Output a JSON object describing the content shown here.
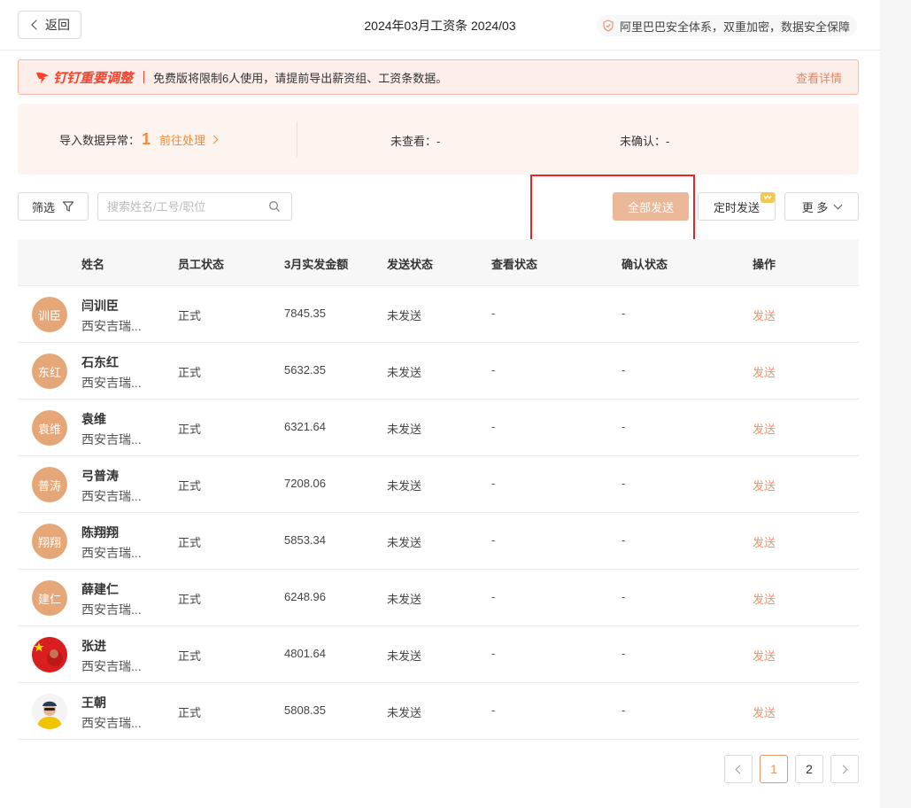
{
  "header": {
    "back_label": "返回",
    "title": "2024年03月工资条 2024/03",
    "security_text": "阿里巴巴安全体系，双重加密，数据安全保障"
  },
  "notice": {
    "brand": "钉钉重要调整",
    "message": "免费版将限制6人使用，请提前导出薪资组、工资条数据。",
    "detail_link": "查看详情"
  },
  "stats": {
    "import_label": "导入数据异常：",
    "import_count": "1",
    "import_action": "前往处理",
    "unviewed": "未查看：-",
    "unconfirmed": "未确认：-"
  },
  "toolbar": {
    "filter_label": "筛选",
    "search_placeholder": "搜索姓名/工号/职位",
    "send_all_label": "全部发送",
    "timed_send_label": "定时发送",
    "more_label": "更 多"
  },
  "table": {
    "columns": [
      "姓名",
      "员工状态",
      "3月实发金额",
      "发送状态",
      "查看状态",
      "确认状态",
      "操作"
    ],
    "rows": [
      {
        "avatar_text": "训臣",
        "avatar_type": "text",
        "name": "闫训臣",
        "org": "西安吉瑞...",
        "status": "正式",
        "amount": "7845.35",
        "send_status": "未发送",
        "view_status": "-",
        "confirm_status": "-",
        "action": "发送"
      },
      {
        "avatar_text": "东红",
        "avatar_type": "text",
        "name": "石东红",
        "org": "西安吉瑞...",
        "status": "正式",
        "amount": "5632.35",
        "send_status": "未发送",
        "view_status": "-",
        "confirm_status": "-",
        "action": "发送"
      },
      {
        "avatar_text": "袁维",
        "avatar_type": "text",
        "name": "袁维",
        "org": "西安吉瑞...",
        "status": "正式",
        "amount": "6321.64",
        "send_status": "未发送",
        "view_status": "-",
        "confirm_status": "-",
        "action": "发送"
      },
      {
        "avatar_text": "普涛",
        "avatar_type": "text",
        "name": "弓普涛",
        "org": "西安吉瑞...",
        "status": "正式",
        "amount": "7208.06",
        "send_status": "未发送",
        "view_status": "-",
        "confirm_status": "-",
        "action": "发送"
      },
      {
        "avatar_text": "翔翔",
        "avatar_type": "text",
        "name": "陈翔翔",
        "org": "西安吉瑞...",
        "status": "正式",
        "amount": "5853.34",
        "send_status": "未发送",
        "view_status": "-",
        "confirm_status": "-",
        "action": "发送"
      },
      {
        "avatar_text": "建仁",
        "avatar_type": "text",
        "name": "薛建仁",
        "org": "西安吉瑞...",
        "status": "正式",
        "amount": "6248.96",
        "send_status": "未发送",
        "view_status": "-",
        "confirm_status": "-",
        "action": "发送"
      },
      {
        "avatar_text": "",
        "avatar_type": "flag-photo",
        "name": "张进",
        "org": "西安吉瑞...",
        "status": "正式",
        "amount": "4801.64",
        "send_status": "未发送",
        "view_status": "-",
        "confirm_status": "-",
        "action": "发送"
      },
      {
        "avatar_text": "",
        "avatar_type": "person-photo",
        "name": "王朝",
        "org": "西安吉瑞...",
        "status": "正式",
        "amount": "5808.35",
        "send_status": "未发送",
        "view_status": "-",
        "confirm_status": "-",
        "action": "发送"
      }
    ]
  },
  "pagination": {
    "pages": [
      "1",
      "2"
    ],
    "current": "1"
  },
  "colors": {
    "accent": "#e8956b",
    "notice_brand": "#f5432c",
    "avatar_bg": "#e5a777",
    "highlight_box": "#ee2222"
  }
}
